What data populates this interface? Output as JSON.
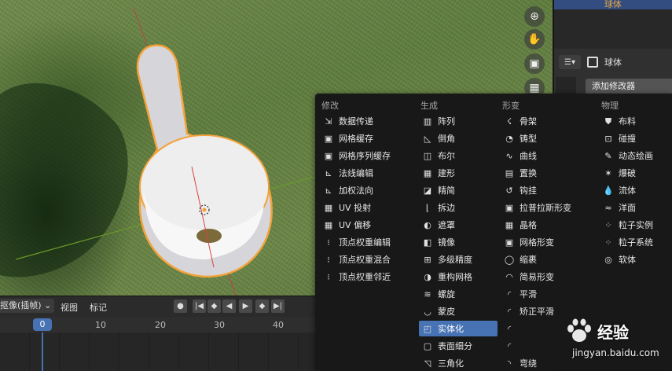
{
  "outliner": {
    "object_label": "球体"
  },
  "properties": {
    "object_name": "球体",
    "add_modifier_label": "添加修改器"
  },
  "viewport_nav": [
    "zoom-icon",
    "hand-pan-icon",
    "camera-icon",
    "grid-icon"
  ],
  "timeline": {
    "keying_label": "抠像(插帧)",
    "menus": [
      "视图",
      "标记"
    ],
    "current_frame": "0",
    "ticks": [
      "10",
      "20",
      "30",
      "40"
    ]
  },
  "menu": {
    "columns": [
      {
        "header": "修改",
        "items": [
          {
            "label": "数据传递",
            "icon": "data-transfer-icon"
          },
          {
            "label": "网格缓存",
            "icon": "mesh-cache-icon"
          },
          {
            "label": "网格序列缓存",
            "icon": "mesh-sequence-cache-icon"
          },
          {
            "label": "法线编辑",
            "icon": "normal-edit-icon"
          },
          {
            "label": "加权法向",
            "icon": "weighted-normal-icon"
          },
          {
            "label": "UV 投射",
            "icon": "uv-project-icon"
          },
          {
            "label": "UV 偏移",
            "icon": "uv-warp-icon"
          },
          {
            "label": "顶点权重编辑",
            "icon": "vertex-weight-edit-icon"
          },
          {
            "label": "顶点权重混合",
            "icon": "vertex-weight-mix-icon"
          },
          {
            "label": "顶点权重邻近",
            "icon": "vertex-weight-proximity-icon"
          }
        ]
      },
      {
        "header": "生成",
        "items": [
          {
            "label": "阵列",
            "icon": "array-icon"
          },
          {
            "label": "倒角",
            "icon": "bevel-icon"
          },
          {
            "label": "布尔",
            "icon": "boolean-icon"
          },
          {
            "label": "建形",
            "icon": "build-icon"
          },
          {
            "label": "精简",
            "icon": "decimate-icon"
          },
          {
            "label": "拆边",
            "icon": "edge-split-icon"
          },
          {
            "label": "遮罩",
            "icon": "mask-icon"
          },
          {
            "label": "镜像",
            "icon": "mirror-icon"
          },
          {
            "label": "多级精度",
            "icon": "multiresolution-icon"
          },
          {
            "label": "重构网格",
            "icon": "remesh-icon"
          },
          {
            "label": "螺旋",
            "icon": "screw-icon"
          },
          {
            "label": "蒙皮",
            "icon": "skin-icon"
          },
          {
            "label": "实体化",
            "icon": "solidify-icon",
            "highlighted": true
          },
          {
            "label": "表面细分",
            "icon": "subdivision-icon"
          },
          {
            "label": "三角化",
            "icon": "triangulate-icon"
          }
        ]
      },
      {
        "header": "形变",
        "items": [
          {
            "label": "骨架",
            "icon": "armature-icon"
          },
          {
            "label": "铸型",
            "icon": "cast-icon"
          },
          {
            "label": "曲线",
            "icon": "curve-icon"
          },
          {
            "label": "置换",
            "icon": "displace-icon"
          },
          {
            "label": "钩挂",
            "icon": "hook-icon"
          },
          {
            "label": "拉普拉斯形变",
            "icon": "laplacian-deform-icon"
          },
          {
            "label": "晶格",
            "icon": "lattice-icon"
          },
          {
            "label": "网格形变",
            "icon": "mesh-deform-icon"
          },
          {
            "label": "缩裹",
            "icon": "shrinkwrap-icon"
          },
          {
            "label": "简易形变",
            "icon": "simple-deform-icon"
          },
          {
            "label": "平滑",
            "icon": "smooth-icon"
          },
          {
            "label": "矫正平滑",
            "icon": "corrective-smooth-icon"
          },
          {
            "label": "",
            "icon": "laplacian-smooth-icon"
          },
          {
            "label": "",
            "icon": "surface-deform-icon"
          },
          {
            "label": "弯绕",
            "icon": "warp-icon"
          }
        ]
      },
      {
        "header": "物理",
        "items": [
          {
            "label": "布料",
            "icon": "cloth-icon"
          },
          {
            "label": "碰撞",
            "icon": "collision-icon"
          },
          {
            "label": "动态绘画",
            "icon": "dynamic-paint-icon"
          },
          {
            "label": "爆破",
            "icon": "explode-icon"
          },
          {
            "label": "流体",
            "icon": "fluid-icon"
          },
          {
            "label": "洋面",
            "icon": "ocean-icon"
          },
          {
            "label": "粒子实例",
            "icon": "particle-instance-icon"
          },
          {
            "label": "粒子系统",
            "icon": "particle-system-icon"
          },
          {
            "label": "软体",
            "icon": "soft-body-icon"
          }
        ]
      }
    ]
  },
  "watermark": {
    "text": "经验",
    "url": "jingyan.baidu.com"
  }
}
